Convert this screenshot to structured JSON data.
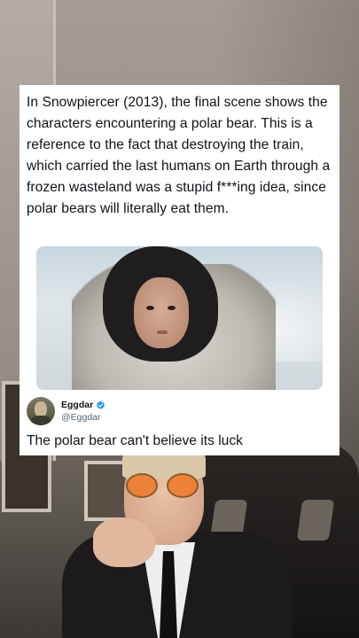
{
  "tweet": {
    "text": "In Snowpiercer (2013), the final scene shows the characters encountering a polar bear. This is a reference to the fact that destroying the train, which carried the last humans on Earth through a frozen wasteland was a stupid f***ing idea, since polar bears will literally eat them."
  },
  "reply": {
    "display_name": "Eggdar",
    "handle": "@Eggdar",
    "verified_icon": "verified-badge-icon",
    "text": "The polar bear can't believe its luck"
  },
  "colors": {
    "card_bg": "#ffffff",
    "text": "#0f1419",
    "secondary_text": "#536471",
    "verified": "#1d9bf0"
  }
}
